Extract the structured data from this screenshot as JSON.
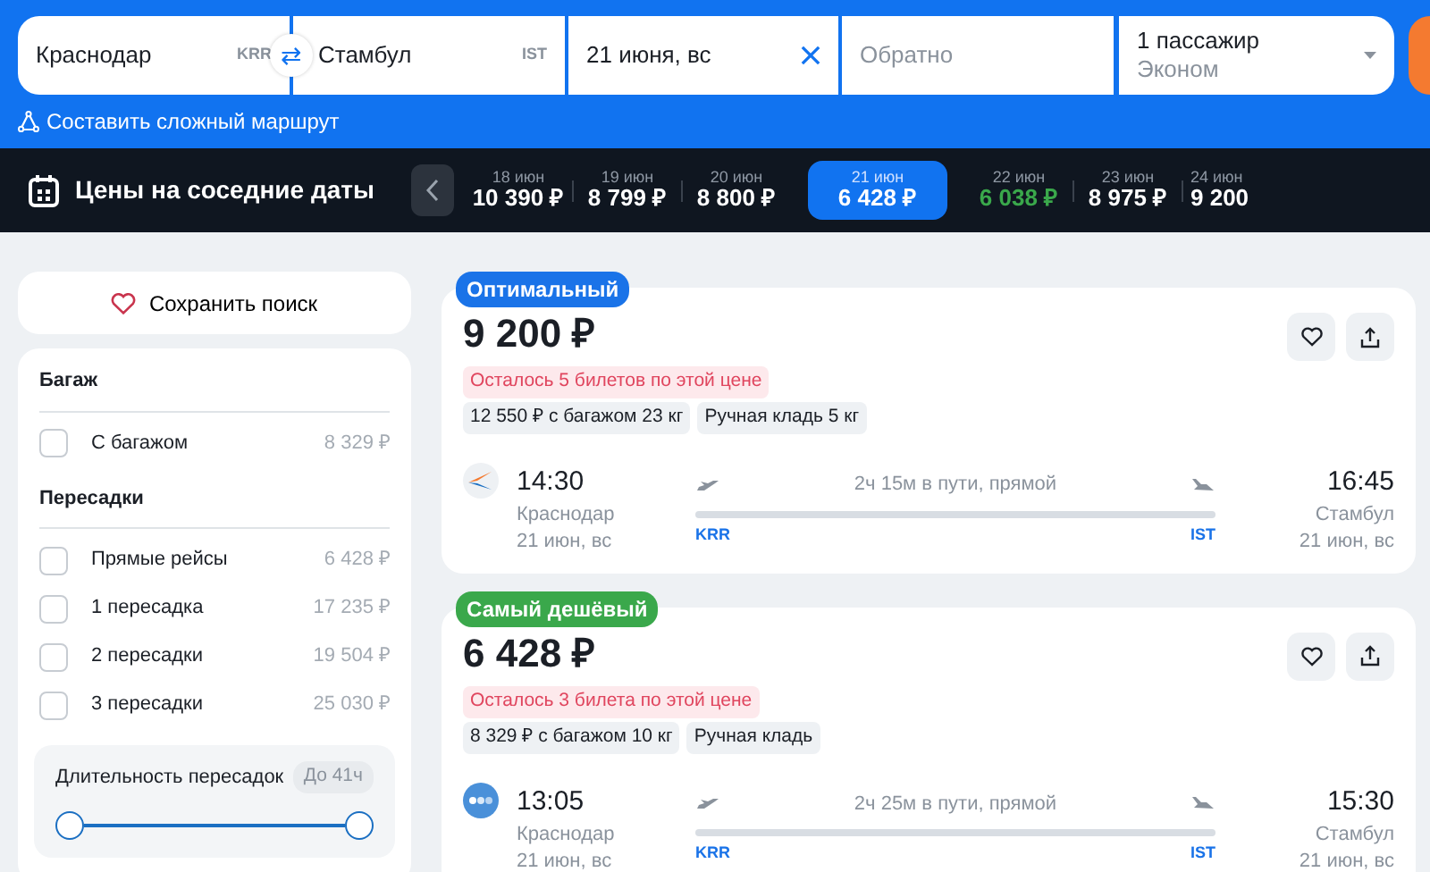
{
  "search": {
    "origin": {
      "value": "Краснодар",
      "code": "KRR"
    },
    "swap": "⇄",
    "destination": {
      "value": "Стамбул",
      "code": "IST"
    },
    "date": {
      "value": "21 июня, вс"
    },
    "return": {
      "placeholder": "Обратно"
    },
    "passengers": {
      "count": "1 пассажир",
      "class": "Эконом"
    }
  },
  "complex_route": "Составить сложный маршрут",
  "nearby_dates": {
    "title": "Цены на соседние даты",
    "dates": [
      {
        "date": "18 июн",
        "price": "10 390 ₽",
        "selected": false,
        "lowest": false
      },
      {
        "date": "19 июн",
        "price": "8 799 ₽",
        "selected": false,
        "lowest": false
      },
      {
        "date": "20 июн",
        "price": "8 800 ₽",
        "selected": false,
        "lowest": false
      },
      {
        "date": "21 июн",
        "price": "6 428 ₽",
        "selected": true,
        "lowest": false
      },
      {
        "date": "22 июн",
        "price": "6 038 ₽",
        "selected": false,
        "lowest": true
      },
      {
        "date": "23 июн",
        "price": "8 975 ₽",
        "selected": false,
        "lowest": false
      },
      {
        "date": "24 июн",
        "price": "9 200",
        "selected": false,
        "lowest": false
      }
    ]
  },
  "sidebar": {
    "save_search": "Сохранить поиск",
    "sections": [
      {
        "title": "Багаж",
        "options": [
          {
            "label": "С багажом",
            "price": "8 329 ₽",
            "checked": false
          }
        ]
      },
      {
        "title": "Пересадки",
        "options": [
          {
            "label": "Прямые рейсы",
            "price": "6 428 ₽",
            "checked": false
          },
          {
            "label": "1 пересадка",
            "price": "17 235 ₽",
            "checked": false
          },
          {
            "label": "2 пересадки",
            "price": "19 504 ₽",
            "checked": false
          },
          {
            "label": "3 пересадки",
            "price": "25 030 ₽",
            "checked": false
          }
        ]
      }
    ],
    "layover_duration": {
      "label": "Длительность пересадок",
      "value": "До 41ч",
      "level": 1
    }
  },
  "tickets": [
    {
      "badge": {
        "text": "Оптимальный",
        "color": "#1a73e8"
      },
      "price": "9 200 ₽",
      "warning": "Осталось 5 билетов по этой цене",
      "tags": [
        "12 550 ₽ с багажом 23 кг",
        "Ручная кладь 5 кг"
      ],
      "logo": {
        "kind": "swoosh"
      },
      "depart": {
        "time": "14:30",
        "city": "Краснодар",
        "date": "21 июн, вс"
      },
      "duration": "2ч 15м в пути, прямой",
      "from_code": "KRR",
      "to_code": "IST",
      "arrive": {
        "time": "16:45",
        "city": "Стамбул",
        "date": "21 июн, вс"
      }
    },
    {
      "badge": {
        "text": "Самый дешёвый",
        "color": "#3aa84b"
      },
      "price": "6 428 ₽",
      "warning": "Осталось 3 билета по этой цене",
      "tags": [
        "8 329 ₽ с багажом 10 кг",
        "Ручная кладь"
      ],
      "logo": {
        "kind": "dots"
      },
      "depart": {
        "time": "13:05",
        "city": "Краснодар",
        "date": "21 июн, вс"
      },
      "duration": "2ч 25м в пути, прямой",
      "from_code": "KRR",
      "to_code": "IST",
      "arrive": {
        "time": "15:30",
        "city": "Стамбул",
        "date": "21 июн, вс"
      }
    }
  ]
}
